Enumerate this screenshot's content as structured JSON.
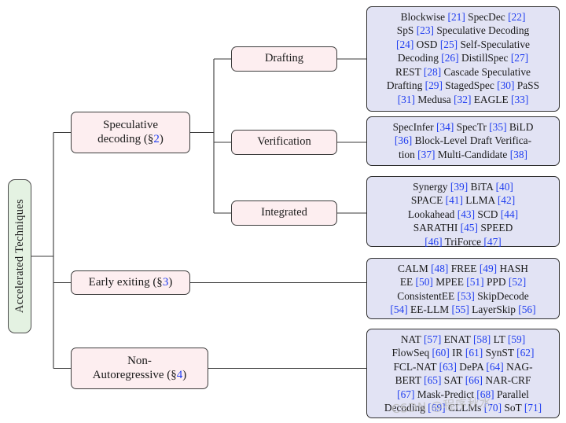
{
  "figure": {
    "type": "taxonomy-tree",
    "orientation": "left-to-right",
    "colors": {
      "root_fill": "#e4f2e2",
      "category_fill": "#fdeef0",
      "leaf_fill": "#e2e3f4",
      "border": "#3d3d3d",
      "reference_link": "#1f3df0"
    }
  },
  "root": {
    "label": "Accelerated Techniques"
  },
  "branches": [
    {
      "id": "speculative-decoding",
      "label_line1": "Speculative",
      "label_line2_prefix": "decoding (§",
      "section": "2",
      "label_line2_suffix": ")",
      "children": [
        {
          "id": "drafting",
          "label": "Drafting",
          "leaf_lines": [
            "Blockwise [21] SpecDec [22]",
            "SpS [23] Speculative Decoding",
            "[24] OSD [25] Self-Speculative",
            "Decoding [26] DistillSpec [27]",
            "REST [28] Cascade Speculative",
            "Drafting [29] StagedSpec [30] PaSS",
            "[31] Medusa [32] EAGLE [33]"
          ],
          "entries": [
            {
              "name": "Blockwise",
              "ref": "21"
            },
            {
              "name": "SpecDec",
              "ref": "22"
            },
            {
              "name": "SpS",
              "ref": "23"
            },
            {
              "name": "Speculative Decoding",
              "ref": "24"
            },
            {
              "name": "OSD",
              "ref": "25"
            },
            {
              "name": "Self-Speculative Decoding",
              "ref": "26"
            },
            {
              "name": "DistillSpec",
              "ref": "27"
            },
            {
              "name": "REST",
              "ref": "28"
            },
            {
              "name": "Cascade Speculative Drafting",
              "ref": "29"
            },
            {
              "name": "StagedSpec",
              "ref": "30"
            },
            {
              "name": "PaSS",
              "ref": "31"
            },
            {
              "name": "Medusa",
              "ref": "32"
            },
            {
              "name": "EAGLE",
              "ref": "33"
            }
          ]
        },
        {
          "id": "verification",
          "label": "Verification",
          "leaf_lines": [
            "SpecInfer [34] SpecTr [35] BiLD",
            "[36] Block-Level Draft Verifica-",
            "tion [37] Multi-Candidate [38]"
          ],
          "entries": [
            {
              "name": "SpecInfer",
              "ref": "34"
            },
            {
              "name": "SpecTr",
              "ref": "35"
            },
            {
              "name": "BiLD",
              "ref": "36"
            },
            {
              "name": "Block-Level Draft Verification",
              "ref": "37"
            },
            {
              "name": "Multi-Candidate",
              "ref": "38"
            }
          ]
        },
        {
          "id": "integrated",
          "label": "Integrated",
          "leaf_lines": [
            "Synergy [39] BiTA [40]",
            "SPACE [41] LLMA [42]",
            "Lookahead [43] SCD [44]",
            "SARATHI [45] SPEED",
            "[46] TriForce [47]"
          ],
          "entries": [
            {
              "name": "Synergy",
              "ref": "39"
            },
            {
              "name": "BiTA",
              "ref": "40"
            },
            {
              "name": "SPACE",
              "ref": "41"
            },
            {
              "name": "LLMA",
              "ref": "42"
            },
            {
              "name": "Lookahead",
              "ref": "43"
            },
            {
              "name": "SCD",
              "ref": "44"
            },
            {
              "name": "SARATHI",
              "ref": "45"
            },
            {
              "name": "SPEED",
              "ref": "46"
            },
            {
              "name": "TriForce",
              "ref": "47"
            }
          ]
        }
      ]
    },
    {
      "id": "early-exiting",
      "label_line1": "Early exiting (§",
      "section": "3",
      "label_line2_suffix": ")",
      "leaf_lines": [
        "CALM [48] FREE [49] HASH",
        "EE [50] MPEE [51] PPD [52]",
        "ConsistentEE [53] SkipDecode",
        "[54] EE-LLM [55] LayerSkip [56]"
      ],
      "entries": [
        {
          "name": "CALM",
          "ref": "48"
        },
        {
          "name": "FREE",
          "ref": "49"
        },
        {
          "name": "HASH EE",
          "ref": "50"
        },
        {
          "name": "MPEE",
          "ref": "51"
        },
        {
          "name": "PPD",
          "ref": "52"
        },
        {
          "name": "ConsistentEE",
          "ref": "53"
        },
        {
          "name": "SkipDecode",
          "ref": "54"
        },
        {
          "name": "EE-LLM",
          "ref": "55"
        },
        {
          "name": "LayerSkip",
          "ref": "56"
        }
      ]
    },
    {
      "id": "non-autoregressive",
      "label_line1": "Non-",
      "label_line2_prefix": "Autoregressive (§",
      "section": "4",
      "label_line2_suffix": ")",
      "leaf_lines": [
        "NAT [57] ENAT [58] LT [59]",
        "FlowSeq [60] IR [61] SynST [62]",
        "FCL-NAT [63] DePA [64] NAG-",
        "BERT [65] SAT [66] NAR-CRF",
        "[67] Mask-Predict [68] Parallel",
        "Decoding [69] CLLMs [70] SoT [71]"
      ],
      "entries": [
        {
          "name": "NAT",
          "ref": "57"
        },
        {
          "name": "ENAT",
          "ref": "58"
        },
        {
          "name": "LT",
          "ref": "59"
        },
        {
          "name": "FlowSeq",
          "ref": "60"
        },
        {
          "name": "IR",
          "ref": "61"
        },
        {
          "name": "SynST",
          "ref": "62"
        },
        {
          "name": "FCL-NAT",
          "ref": "63"
        },
        {
          "name": "DePA",
          "ref": "64"
        },
        {
          "name": "NAG-BERT",
          "ref": "65"
        },
        {
          "name": "SAT",
          "ref": "66"
        },
        {
          "name": "NAR-CRF",
          "ref": "67"
        },
        {
          "name": "Mask-Predict",
          "ref": "68"
        },
        {
          "name": "Parallel Decoding",
          "ref": "69"
        },
        {
          "name": "CLLMs",
          "ref": "70"
        },
        {
          "name": "SoT",
          "ref": "71"
        }
      ]
    }
  ],
  "watermark": {
    "text": "CSDN @程序秋水"
  }
}
